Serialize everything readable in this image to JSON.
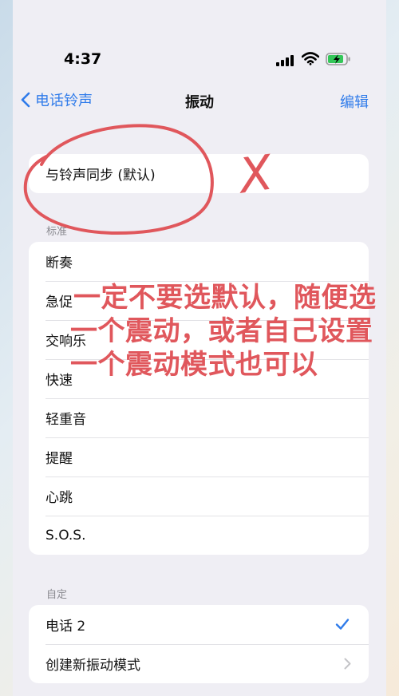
{
  "status_bar": {
    "time": "4:37"
  },
  "nav": {
    "back_label": "电话铃声",
    "title": "振动",
    "edit_label": "编辑"
  },
  "sync_row": {
    "label": "与铃声同步 (默认)"
  },
  "standard": {
    "header": "标准",
    "items": [
      "断奏",
      "急促",
      "交响乐",
      "快速",
      "轻重音",
      "提醒",
      "心跳",
      "S.O.S."
    ]
  },
  "custom": {
    "header": "自定",
    "items": [
      {
        "label": "电话 2",
        "selected": true
      },
      {
        "label": "创建新振动模式"
      }
    ]
  },
  "annotation": {
    "lines": [
      "一定不要选默认，随便选",
      "一个震动，或者自己设置",
      "一个震动模式也可以"
    ],
    "mark": "X",
    "color": "#e0575c"
  },
  "colors": {
    "accent": "#2f7bea",
    "background": "#efeef4",
    "annotation": "#e0575c"
  }
}
